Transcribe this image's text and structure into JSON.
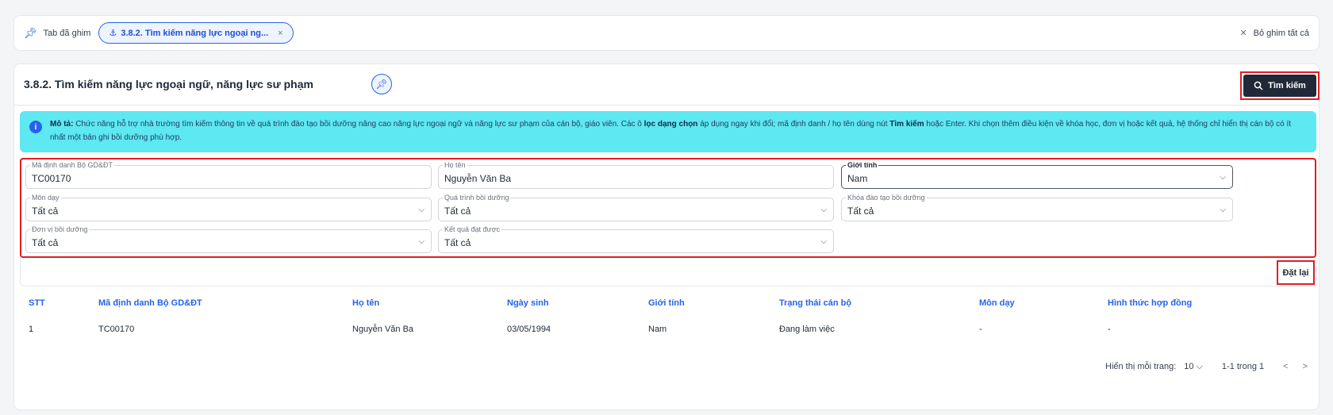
{
  "tabbar": {
    "label": "Tab đã ghim",
    "active_tab": "3.8.2. Tìm kiếm năng lực ngoại ng...",
    "close_glyph": "×",
    "unpin_all": "Bỏ ghim tất cả",
    "pin_icon": "pin-icon",
    "anchor_icon": "anchor-icon",
    "unpin_icon": "unpin-icon"
  },
  "page": {
    "title": "3.8.2. Tìm kiếm năng lực ngoại ngữ, năng lực sư phạm",
    "search_label": "Tìm kiếm",
    "reset_label": "Đặt lại"
  },
  "description": {
    "label": "Mô tả:",
    "part1": " Chức năng hỗ trợ nhà trường tìm kiếm thông tin về quá trình đào tạo bồi dưỡng nâng cao năng lực ngoại ngữ và năng lực sư phạm của cán bộ, giáo viên. Các ô ",
    "bold1": "lọc dạng chọn",
    "part2": " áp dụng ngay khi đổi; mã định danh / họ tên dùng nút ",
    "bold2": "Tìm kiếm",
    "part3": " hoặc Enter. Khi chọn thêm điều kiện về khóa học, đơn vị hoặc kết quả, hệ thống chỉ hiển thị cán bộ có ít nhất một bản ghi bồi dưỡng phù hợp."
  },
  "filters": {
    "ma_dinh_danh": {
      "label": "Mã định danh Bộ GD&ĐT",
      "value": "TC00170"
    },
    "ho_ten": {
      "label": "Họ tên",
      "value": "Nguyễn Văn Ba"
    },
    "gioi_tinh": {
      "label": "Giới tính",
      "value": "Nam"
    },
    "mon_day": {
      "label": "Môn dạy",
      "value": "Tất cả"
    },
    "qua_trinh": {
      "label": "Quá trình bồi dưỡng",
      "value": "Tất cả"
    },
    "khoa_dao_tao": {
      "label": "Khóa đào tạo bồi dưỡng",
      "value": "Tất cả"
    },
    "don_vi": {
      "label": "Đơn vị bồi dưỡng",
      "value": "Tất cả"
    },
    "ket_qua": {
      "label": "Kết quả đạt được",
      "value": "Tất cả"
    }
  },
  "table": {
    "headers": [
      "STT",
      "Mã định danh Bộ GD&ĐT",
      "Họ tên",
      "Ngày sinh",
      "Giới tính",
      "Trạng thái cán bộ",
      "Môn dạy",
      "Hình thức hợp đồng"
    ],
    "rows": [
      [
        "1",
        "TC00170",
        "Nguyễn Văn Ba",
        "03/05/1994",
        "Nam",
        "Đang làm việc",
        "-",
        "-"
      ]
    ]
  },
  "pagination": {
    "per_page_label": "Hiển thị mỗi trang:",
    "per_page": "10",
    "range": "1-1 trong 1",
    "prev": "<",
    "next": ">"
  }
}
